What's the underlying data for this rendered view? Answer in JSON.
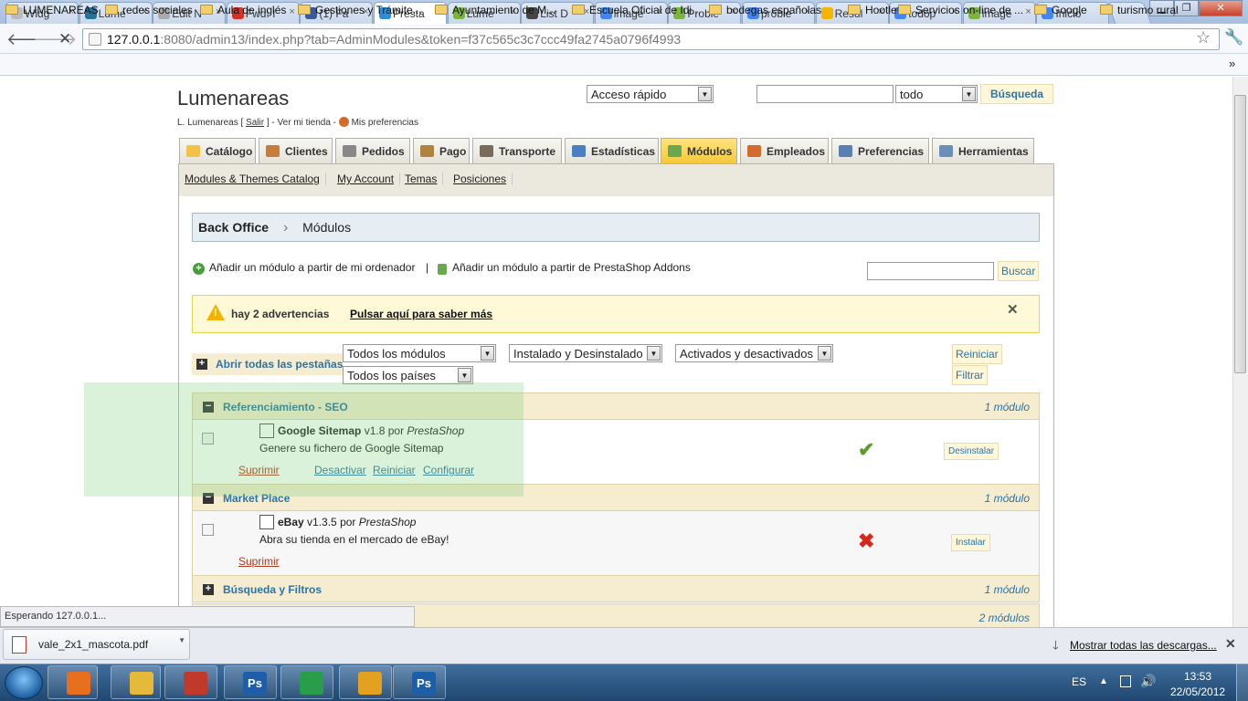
{
  "browser": {
    "tabs": [
      {
        "label": "Widg",
        "color": "#bbbbbb"
      },
      {
        "label": "Lume",
        "color": "#21759b"
      },
      {
        "label": "Edit N",
        "color": "#aaaaaa"
      },
      {
        "label": "Fwd: I",
        "color": "#d93025"
      },
      {
        "label": "(1) Fa",
        "color": "#3b5998"
      },
      {
        "label": "Presta",
        "color": "#2d8ed8"
      },
      {
        "label": "Lume",
        "color": "#7cb342"
      },
      {
        "label": "List D",
        "color": "#444444"
      },
      {
        "label": "image",
        "color": "#4285f4"
      },
      {
        "label": "Proble",
        "color": "#7cb342"
      },
      {
        "label": "proble",
        "color": "#4285f4"
      },
      {
        "label": "Resul",
        "color": "#f4b400"
      },
      {
        "label": "todop",
        "color": "#4285f4"
      },
      {
        "label": "image",
        "color": "#7cb342"
      },
      {
        "label": "Inicio",
        "color": "#4285f4"
      }
    ],
    "url_host": "127.0.0.1",
    "url_rest": ":8080/admin13/index.php?tab=AdminModules&token=f37c565c3c7ccc49fa2745a0796f4993",
    "bookmarks": [
      "LUMENAREAS",
      "redes sociales",
      "Aula de inglés",
      "Gestiones y Trámite...",
      "Ayuntamiento de M...",
      "Escuela Oficial de Idi...",
      "bodegas españolas",
      "Hootlet",
      "Servicios on-line de ...",
      "Google",
      "turismo rural"
    ],
    "bookmarks_more": "»",
    "status_text": "Esperando 127.0.0.1..."
  },
  "header": {
    "shop_name": "Lumenareas",
    "quick_access": "Acceso rápido",
    "search_scope": "todo",
    "search_button": "Búsqueda",
    "user_prefix": "L. Lumenareas [",
    "logout": "Salir",
    "user_mid": "] -",
    "view_shop": "Ver mi tienda",
    "prefs_sep": "-",
    "preferences": "Mis preferencias"
  },
  "main_tabs": [
    {
      "label": "Catálogo",
      "color": "#f1c14a"
    },
    {
      "label": "Clientes",
      "color": "#c97c3a"
    },
    {
      "label": "Pedidos",
      "color": "#888888"
    },
    {
      "label": "Pago",
      "color": "#b0843e"
    },
    {
      "label": "Transporte",
      "color": "#7a6a5a"
    },
    {
      "label": "Estadísticas",
      "color": "#4a7fc1"
    },
    {
      "label": "Módulos",
      "color": "#6aa84f"
    },
    {
      "label": "Empleados",
      "color": "#d36a2e"
    },
    {
      "label": "Preferencias",
      "color": "#5a7fb0"
    },
    {
      "label": "Herramientas",
      "color": "#6a8fb8"
    }
  ],
  "sub_tabs": [
    "Modules & Themes Catalog",
    "My Account",
    "Temas",
    "Posiciones"
  ],
  "breadcrumb": {
    "root": "Back Office",
    "separator": "›",
    "current": "Módulos"
  },
  "add_module": {
    "from_computer": "Añadir un módulo a partir de mi ordenador",
    "separator": "|",
    "from_addons": "Añadir un módulo a partir de PrestaShop Addons"
  },
  "search_button": "Buscar",
  "warning": {
    "text": "hay 2 advertencias",
    "link": "Pulsar aquí para saber más",
    "close": "✕"
  },
  "filters": {
    "open_all": "Abrir todas las pestañas",
    "modules": "Todos los módulos",
    "installed": "Instalado y Desinstalado",
    "active": "Activados y desactivados",
    "countries": "Todos los países",
    "reset": "Reiniciar",
    "filter": "Filtrar"
  },
  "categories": [
    {
      "name": "Referenciamiento - SEO",
      "count": "1 módulo",
      "expanded": true,
      "module": {
        "name": "Google Sitemap",
        "version": "v1.8",
        "by": "por",
        "author": "PrestaShop",
        "description": "Genere su fichero de Google Sitemap",
        "status_icon": "check-icon",
        "action": "Desinstalar",
        "links": [
          "Suprimir",
          "Desactivar",
          "Reiniciar",
          "Configurar"
        ]
      }
    },
    {
      "name": "Market Place",
      "count": "1 módulo",
      "expanded": true,
      "module": {
        "name": "eBay",
        "version": "v1.3.5",
        "by": "por",
        "author": "PrestaShop",
        "description": "Abra su tienda en el mercado de eBay!",
        "status_icon": "cross-icon",
        "action": "Instalar",
        "links": [
          "Suprimir"
        ]
      }
    },
    {
      "name": "Búsqueda y Filtros",
      "count": "1 módulo",
      "expanded": false
    },
    {
      "name": "",
      "count": "2 módulos",
      "expanded": false
    }
  ],
  "downloads": {
    "file": "vale_2x1_mascota.pdf",
    "show_all": "Mostrar todas las descargas..."
  },
  "taskbar": {
    "apps": [
      {
        "label": "",
        "color": "#e76f1e"
      },
      {
        "label": "",
        "color": "#e6b93a"
      },
      {
        "label": "",
        "color": "#c0392b"
      },
      {
        "label": "Ps",
        "color": "#1c5ea8"
      },
      {
        "label": "",
        "color": "#2a9d4a"
      },
      {
        "label": "",
        "color": "#e3a11f"
      },
      {
        "label": "Ps",
        "color": "#1c5ea8"
      }
    ],
    "lang": "ES",
    "time": "13:53",
    "date": "22/05/2012"
  }
}
